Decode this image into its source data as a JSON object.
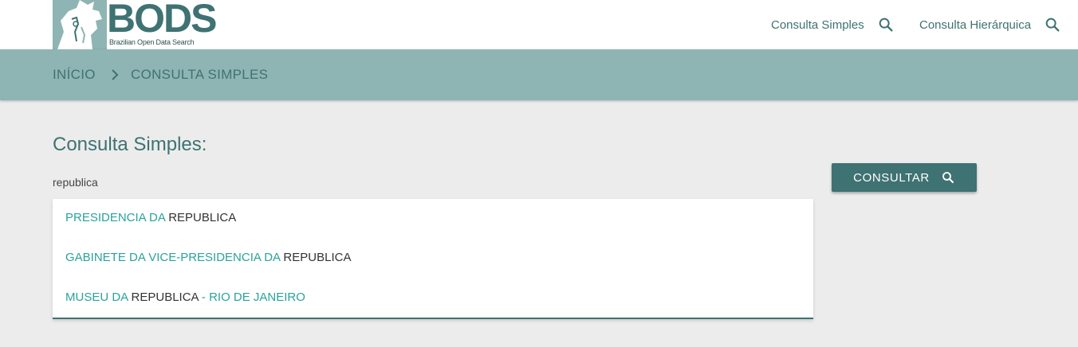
{
  "brand": {
    "name": "BODS",
    "tagline": "Brazilian Open Data Search",
    "color": "#3f7272"
  },
  "nav": [
    {
      "label": "Consulta Simples",
      "icon": "search-icon"
    },
    {
      "label": "Consulta Hierárquica",
      "icon": "search-icon"
    }
  ],
  "breadcrumb": {
    "home": "INÍCIO",
    "separator_icon": "chevron-right-icon",
    "current": "CONSULTA SIMPLES"
  },
  "main": {
    "title": "Consulta Simples:",
    "search_value": "republica",
    "button_label": "CONSULTAR",
    "button_icon": "search-icon"
  },
  "suggestions": [
    {
      "pre": "PRESIDENCIA DA",
      "match": "REPUBLICA",
      "post": ""
    },
    {
      "pre": "GABINETE DA VICE-PRESIDENCIA DA",
      "match": "REPUBLICA",
      "post": ""
    },
    {
      "pre": "MUSEU DA",
      "match": "REPUBLICA",
      "post": "- RIO DE JANEIRO"
    }
  ],
  "colors": {
    "header_bg": "#8fb4b4",
    "accent": "#3f7272",
    "highlight": "#2aa39a",
    "page_bg": "#ececec"
  }
}
